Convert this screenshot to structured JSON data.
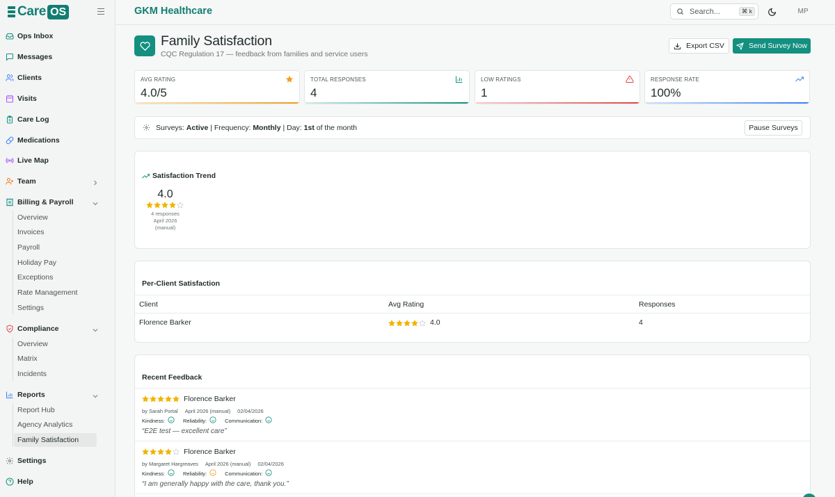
{
  "app": {
    "logo_care": "Care",
    "logo_os": "OS",
    "brand_color": "#127e71",
    "accent_color": "#13907f"
  },
  "sidebar": {
    "items": [
      {
        "label": "Ops Inbox",
        "icon": "inbox-icon"
      },
      {
        "label": "Messages",
        "icon": "message-icon"
      },
      {
        "label": "Clients",
        "icon": "users-icon"
      },
      {
        "label": "Visits",
        "icon": "calendar-icon"
      },
      {
        "label": "Care Log",
        "icon": "clipboard-icon"
      },
      {
        "label": "Medications",
        "icon": "pill-icon"
      },
      {
        "label": "Live Map",
        "icon": "radio-icon"
      },
      {
        "label": "Team",
        "icon": "team-icon"
      },
      {
        "label": "Billing & Payroll",
        "icon": "receipt-icon"
      },
      {
        "label": "Compliance",
        "icon": "shield-icon"
      },
      {
        "label": "Reports",
        "icon": "chart-icon"
      },
      {
        "label": "Settings",
        "icon": "gear-icon"
      },
      {
        "label": "Help",
        "icon": "help-icon"
      }
    ],
    "billing_sub": [
      "Overview",
      "Invoices",
      "Payroll",
      "Holiday Pay",
      "Exceptions",
      "Rate Management",
      "Settings"
    ],
    "compliance_sub": [
      "Overview",
      "Matrix",
      "Incidents"
    ],
    "reports_sub": [
      "Report Hub",
      "Agency Analytics",
      "Family Satisfaction"
    ]
  },
  "topbar": {
    "org_name": "GKM Healthcare",
    "search_placeholder": "Search...",
    "shortcut": "⌘ k",
    "avatar_initials": "MP"
  },
  "page": {
    "title": "Family Satisfaction",
    "subtitle": "CQC Regulation 17 — feedback from families and service users",
    "export_label": "Export CSV",
    "send_label": "Send Survey Now"
  },
  "stats": [
    {
      "label": "AVG RATING",
      "value": "4.0/5",
      "icon": "star-icon",
      "color": "#f0a020"
    },
    {
      "label": "TOTAL RESPONSES",
      "value": "4",
      "icon": "bar-chart-icon",
      "color": "#13907f"
    },
    {
      "label": "LOW RATINGS",
      "value": "1",
      "icon": "warning-icon",
      "color": "#e0484a"
    },
    {
      "label": "RESPONSE RATE",
      "value": "100%",
      "icon": "trending-up-icon",
      "color": "#3b82f6"
    }
  ],
  "survey": {
    "prefix": "Surveys:",
    "status": "Active",
    "sep1": "| Frequency:",
    "frequency": "Monthly",
    "sep2": "| Day:",
    "day": "1st",
    "suffix": "of the month",
    "pause_label": "Pause Surveys"
  },
  "trend": {
    "title": "Satisfaction Trend",
    "value": "4.0",
    "rating": 4,
    "responses": "4 responses",
    "period": "April 2026 (manual)"
  },
  "per_client": {
    "title": "Per-Client Satisfaction",
    "columns": [
      "Client",
      "Avg Rating",
      "Responses"
    ],
    "rows": [
      {
        "client": "Florence Barker",
        "rating": 4,
        "avg": "4.0",
        "responses": "4"
      }
    ]
  },
  "feedback": {
    "title": "Recent Feedback",
    "items": [
      {
        "rating": 5,
        "client": "Florence Barker",
        "by": "by Sarah Portal",
        "period": "April 2026 (manual)",
        "date": "02/04/2026",
        "kindness": "Kindness:",
        "reliability": "Reliability:",
        "communication": "Communication:",
        "moods": [
          "happy",
          "happy",
          "happy"
        ],
        "comment": "“E2E test — excellent care”"
      },
      {
        "rating": 4,
        "client": "Florence Barker",
        "by": "by Margaret Hargreaves",
        "period": "April 2026 (manual)",
        "date": "02/04/2026",
        "kindness": "Kindness:",
        "reliability": "Reliability:",
        "communication": "Communication:",
        "moods": [
          "happy",
          "neutral",
          "happy"
        ],
        "comment": "“I am generally happy with the care, thank you.”"
      }
    ]
  }
}
